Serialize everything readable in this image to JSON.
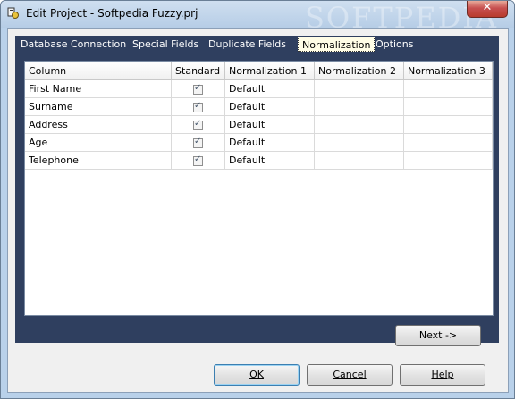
{
  "window": {
    "title": "Edit Project - Softpedia Fuzzy.prj",
    "watermark": "SOFTPEDIA",
    "close_glyph": "✕",
    "app_icon": "app-icon"
  },
  "tabs": [
    {
      "label": "Database Connection",
      "active": false
    },
    {
      "label": "Special Fields",
      "active": false
    },
    {
      "label": "Duplicate Fields",
      "active": false
    },
    {
      "label": "Normalization",
      "active": true
    },
    {
      "label": "Options",
      "active": false
    }
  ],
  "grid": {
    "headers": [
      "Column",
      "Standard",
      "Normalization 1",
      "Normalization 2",
      "Normalization 3"
    ],
    "rows": [
      {
        "column": "First Name",
        "standard": true,
        "norm1": "Default",
        "norm2": "",
        "norm3": ""
      },
      {
        "column": "Surname",
        "standard": true,
        "norm1": "Default",
        "norm2": "",
        "norm3": ""
      },
      {
        "column": "Address",
        "standard": true,
        "norm1": "Default",
        "norm2": "",
        "norm3": ""
      },
      {
        "column": "Age",
        "standard": true,
        "norm1": "Default",
        "norm2": "",
        "norm3": ""
      },
      {
        "column": "Telephone",
        "standard": true,
        "norm1": "Default",
        "norm2": "",
        "norm3": ""
      }
    ]
  },
  "buttons": {
    "next": "Next ->",
    "ok": "OK",
    "cancel": "Cancel",
    "help": "Help"
  },
  "colors": {
    "tab_strip": "#2f3f5f",
    "active_tab": "#fffde6",
    "titlebar": "#b9d1ea"
  }
}
